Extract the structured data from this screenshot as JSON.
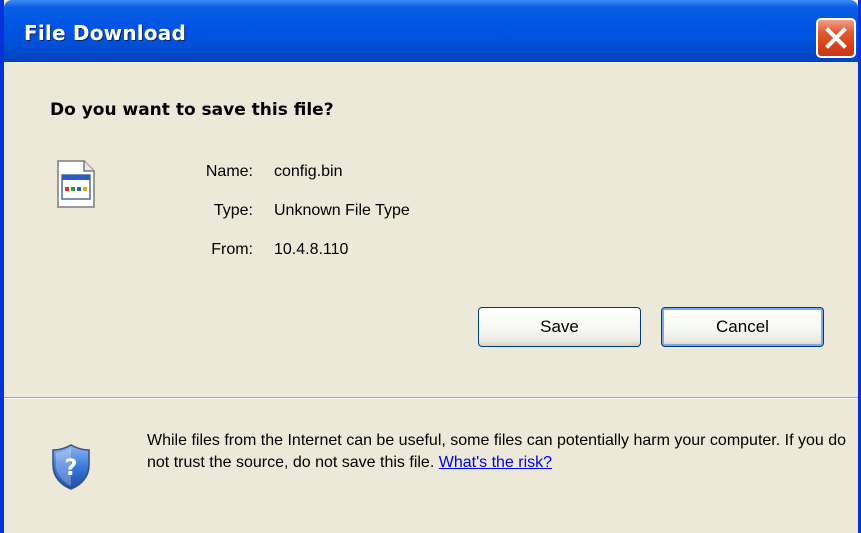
{
  "window": {
    "title": "File Download"
  },
  "prompt": {
    "question": "Do you want to save this file?"
  },
  "file": {
    "name_label": "Name:",
    "name_value": "config.bin",
    "type_label": "Type:",
    "type_value": "Unknown File Type",
    "from_label": "From:",
    "from_value": "10.4.8.110"
  },
  "buttons": {
    "save_label": "Save",
    "cancel_label": "Cancel"
  },
  "warning": {
    "text": "While files from the Internet can be useful, some files can potentially harm your computer. If you do not trust the source, do not save this file. ",
    "link": "What's the risk?"
  },
  "icons": {
    "close": "close-icon",
    "file": "file-icon",
    "shield": "shield-help-icon"
  },
  "colors": {
    "title_bar": "#0055e5",
    "window_bg": "#ece9d8",
    "close_button": "#d8421c",
    "link": "#0000ee"
  }
}
